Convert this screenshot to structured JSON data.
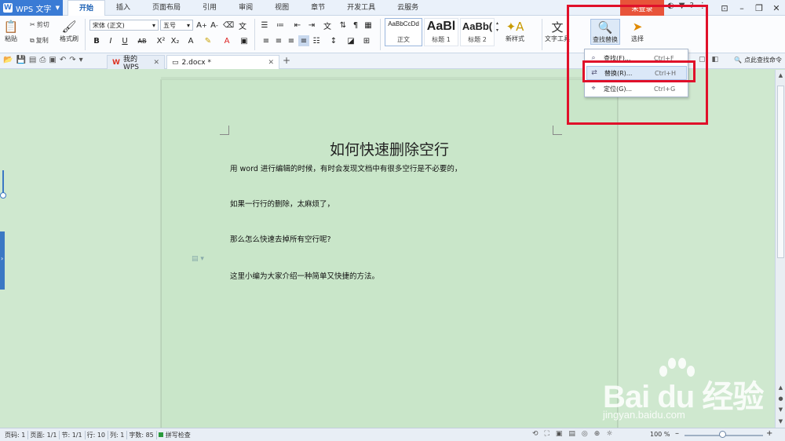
{
  "app": {
    "name": "WPS 文字",
    "logo_letter": "W"
  },
  "menu": {
    "tabs": [
      "开始",
      "插入",
      "页面布局",
      "引用",
      "审阅",
      "视图",
      "章节",
      "开发工具",
      "云服务"
    ],
    "active": "开始",
    "login_label": "未登录"
  },
  "ribbon": {
    "paste_label": "粘贴",
    "cut_label": "剪切",
    "copy_label": "复制",
    "format_painter_label": "格式刷",
    "font_name": "宋体 (正文)",
    "font_size": "五号",
    "styles": [
      {
        "sample": "AaBbCcDd",
        "label": "正文"
      },
      {
        "sample": "AaBl",
        "label": "标题 1"
      },
      {
        "sample": "AaBb(",
        "label": "标题 2"
      }
    ],
    "new_style_label": "新样式",
    "text_tools_label": "文字工具",
    "find_replace_label": "查找替换",
    "select_label": "选择"
  },
  "tabs_bar": {
    "docs": [
      {
        "title": "我的WPS",
        "active": false
      },
      {
        "title": "2.docx *",
        "active": true
      }
    ],
    "find_command_label": "点此查找命令"
  },
  "dropdown": {
    "items": [
      {
        "label": "查找(F)...",
        "shortcut": "Ctrl+F",
        "icon": "find-icon"
      },
      {
        "label": "替换(R)...",
        "shortcut": "Ctrl+H",
        "icon": "replace-icon"
      },
      {
        "label": "定位(G)...",
        "shortcut": "Ctrl+G",
        "icon": "goto-icon"
      }
    ],
    "highlighted_index": 1
  },
  "document": {
    "title": "如何快速删除空行",
    "lines": [
      "用 word 进行编辑的时候，有时会发现文档中有很多空行是不必要的，",
      "如果一行行的删除，太麻烦了，",
      "那么怎么快速去掉所有空行呢?",
      "这里小编为大家介绍一种简单又快捷的方法。"
    ]
  },
  "status": {
    "page_code": "页码: 1",
    "page": "页面: 1/1",
    "section": "节: 1/1",
    "row": "行: 10",
    "col": "列: 1",
    "word_count": "字数: 85",
    "spell_check": "拼写检查",
    "zoom": "100 %"
  },
  "watermark": {
    "brand": "Bai du 经验",
    "url": "jingyan.baidu.com"
  },
  "colors": {
    "accent": "#3a7bd5",
    "highlight_red": "#e0102a",
    "page_bg": "#c9e6c9",
    "login_red": "#e8543a"
  }
}
